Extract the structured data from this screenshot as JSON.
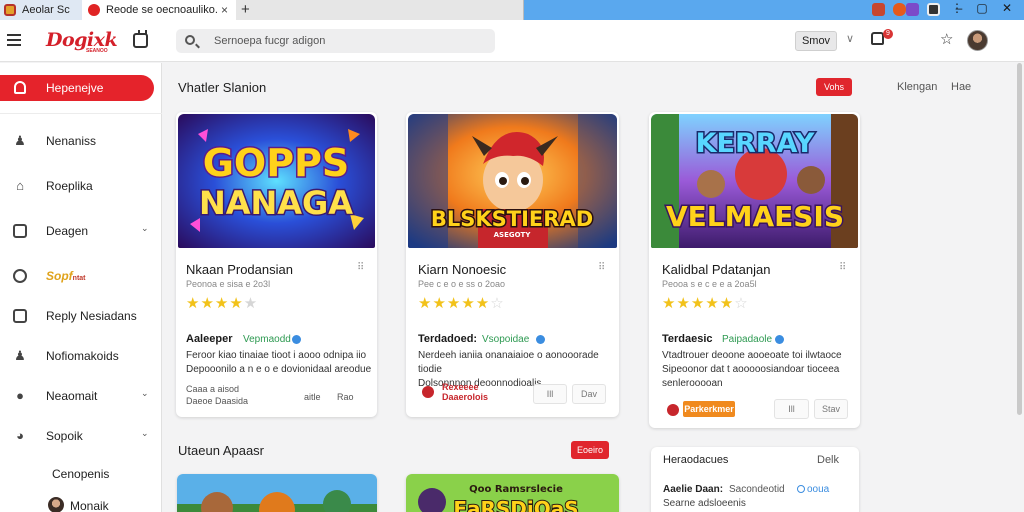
{
  "browser": {
    "tabs": [
      {
        "label": "Aeolar Sc"
      },
      {
        "label": "Reode se oecnoauliko."
      }
    ],
    "tab_close": "×",
    "new_tab": "+"
  },
  "header": {
    "logo": "Dogixk",
    "logo_sub": "SEANOO",
    "search_placeholder": "Sernoepa fucgr adigon",
    "show_button": "Smov",
    "chevron": "∨",
    "notif_count": "9",
    "star": "☆"
  },
  "sidebar": {
    "active": {
      "label": "Hepenejve"
    },
    "items": [
      {
        "label": "Nenaniss"
      },
      {
        "label": "Roeplika"
      },
      {
        "label": "Deagen"
      },
      {
        "label": "Reply Nesiadans"
      },
      {
        "label": "Nofiomakoids"
      },
      {
        "label": "Neaomait"
      },
      {
        "label": "Sopoik"
      }
    ],
    "gold_badge": "Sopf",
    "gold_badge_small": "ntat",
    "sub_items": [
      {
        "label": "Cenopenis"
      },
      {
        "label": "Monaik"
      }
    ],
    "chevron": "⌄"
  },
  "section1": {
    "title": "Vhatler Slanion",
    "pill": "Vohs",
    "link1": "Klengan",
    "link2": "Hae"
  },
  "cards": [
    {
      "art_line1": "GOPPS",
      "art_line2": "NANAGA",
      "title": "Nkaan Prodansian",
      "sub": "Peonoa e sisa e 2o3l",
      "stars": 4,
      "author": "Aaleeper",
      "verified": "Vepmaodd",
      "desc1": "Feroor kiao tinaiae tioot i aooo odnipa iio",
      "desc2": "Depooonilo a n e o e dovionidaal areodue",
      "meta1": "Caaa a aisod",
      "meta2": "Daeoe Daasida",
      "btn1": "aitle",
      "btn2": "Rao"
    },
    {
      "art_line1": "BLSKSTIERAD",
      "art_sub": "ASEGOTY",
      "title": "Kiarn Nonoesic",
      "sub": "Pee c e o e ss o 2oao",
      "stars": 5,
      "author": "Terdadoed:",
      "verified": "Vsopoidae",
      "desc1": "Nerdeeh ianiia onanaiaioe o aonooorade tiodie",
      "desc2": "Dolsonnnon deoonnodioalis.",
      "brand1": "Rexeeee",
      "brand2": "Daaerolois",
      "btn1": "Ill",
      "btn2": "Dav"
    },
    {
      "art_line1": "KERRAY",
      "art_line2": "VELMAESIS",
      "title": "Kalidbal Pdatanjan",
      "sub": "Peooa s e c e e a 2oa5l",
      "stars": 5,
      "author": "Terdaesic",
      "verified": "Paipadaole",
      "desc1": "Vtadtrouer deoone aooeoate toi ilwtaoce",
      "desc2": "Sipeoonor dat t aooooosiandoar tioceea",
      "desc3": "senlerooooan",
      "tag": "Parkerkmer",
      "btn1": "Ill",
      "btn2": "Stav"
    }
  ],
  "section2": {
    "title": "Utaeun Apaasr",
    "pill": "Eoeiro",
    "card_a_text": "",
    "card_b_art": "Qoo Ramsrslecie",
    "card_b_art2": "EaRSDiOaS"
  },
  "panel": {
    "title": "Heraodacues",
    "link": "Delk",
    "row_label": "Aaelie Daan:",
    "row_value": "Sacondeotid",
    "row_extra": "ooua",
    "row2": "Searne adsloeenis"
  }
}
